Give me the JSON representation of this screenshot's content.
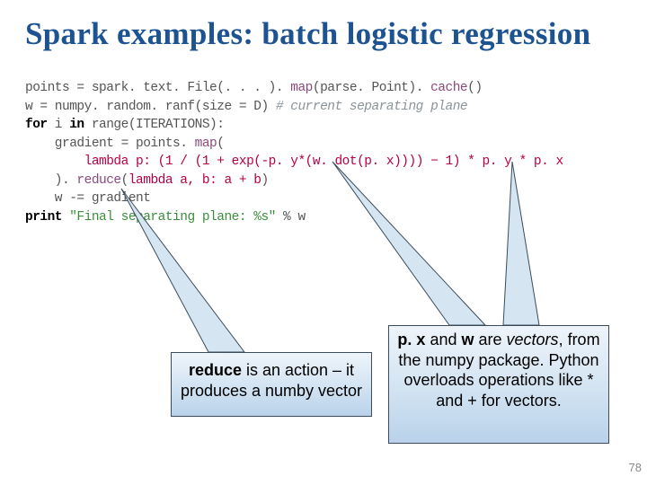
{
  "title": "Spark examples: batch logistic regression",
  "code": {
    "l1a": "points = spark. text. File(. . . ). ",
    "l1b": "map",
    "l1c": "(parse. Point). ",
    "l1d": "cache",
    "l1e": "()",
    "l2a": "w = numpy. random. ranf(size = D) ",
    "l2b": "# current separating plane",
    "l3a": "for",
    "l3b": " i ",
    "l3c": "in",
    "l3d": " range(ITERATIONS):",
    "l4a": "    gradient = points. ",
    "l4b": "map",
    "l4c": "(",
    "l5a": "        ",
    "l5b": "lambda",
    "l5c": " p: (1 / (1 + exp(-p. y*(w. dot(p. x)))) − 1) * p. y * p. x",
    "l6a": "    ). ",
    "l6b": "reduce",
    "l6c": "(",
    "l6d": "lambda",
    "l6e": " a, b: a + b",
    "l6f": ")",
    "l7": "    w -= gradient",
    "l8a": "print",
    "l8b": " ",
    "l8c": "\"Final separating plane: %s\"",
    "l8d": " % w"
  },
  "callouts": {
    "reduce": {
      "bold": "reduce",
      "rest": " is an action – it produces a numby vector"
    },
    "vectors": {
      "l1a": "p. x",
      "l1b": " and ",
      "l1c": "w",
      "l1d": " are ",
      "l1e": "vectors",
      "l1f": ", from the numpy package.  Python overloads operations like * and + for vectors."
    }
  },
  "page": "78"
}
